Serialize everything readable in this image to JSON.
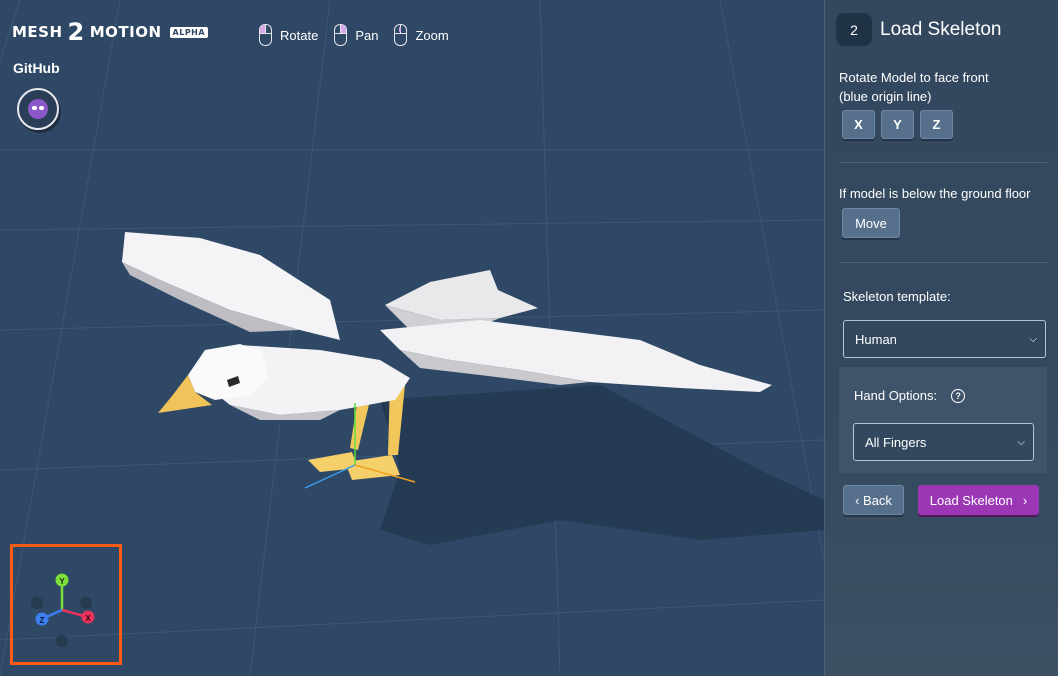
{
  "logo": {
    "word1": "MESH",
    "two": "2",
    "word2": "MOTION",
    "badge": "ALPHA"
  },
  "github": {
    "label": "GitHub"
  },
  "controls": [
    {
      "label": "Rotate",
      "icon": "mouse-left-icon"
    },
    {
      "label": "Pan",
      "icon": "mouse-right-icon"
    },
    {
      "label": "Zoom",
      "icon": "mouse-wheel-icon"
    }
  ],
  "gizmo": {
    "y_label": "Y",
    "x_label": "X",
    "z_label": "Z"
  },
  "panel": {
    "step_number": "2",
    "step_title": "Load Skeleton",
    "rotate_label_line1": "Rotate Model to face front",
    "rotate_label_line2": "(blue origin line)",
    "axis_buttons": [
      "X",
      "Y",
      "Z"
    ],
    "below_label": "If model is below the ground floor",
    "move_label": "Move",
    "template_label": "Skeleton template:",
    "template_value": "Human",
    "hand_label": "Hand Options:",
    "hand_value": "All Fingers",
    "back_label": "‹ Back",
    "load_label": "Load Skeleton",
    "load_chevron": "›"
  },
  "colors": {
    "viewport_bg": "#2e4865",
    "panel_bg": "#33475e",
    "accent_purple": "#9b36b4",
    "highlight_frame": "#ff5a16",
    "axis_y": "#7be03a",
    "axis_x": "#e8335a",
    "axis_z": "#3d7ff0"
  }
}
